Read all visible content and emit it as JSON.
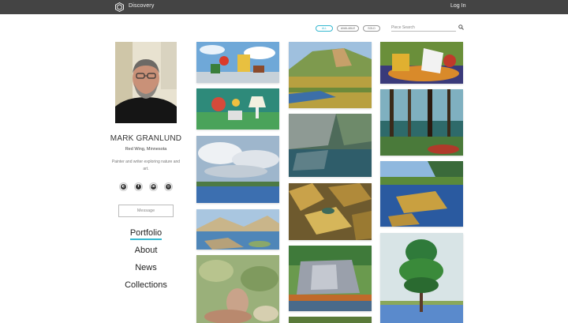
{
  "header": {
    "brand": "Discovery",
    "login": "Log In",
    "logo_icon": "logo-hexagon-icon"
  },
  "filters": {
    "items": [
      "ALL",
      "AVAILABLE",
      "SOLD"
    ],
    "active": "ALL"
  },
  "search": {
    "placeholder": "Piece Search",
    "icon": "search-icon"
  },
  "profile": {
    "name": "MARK GRANLUND",
    "location": "Red Wing, Minnesota",
    "bio": "Painter and writer exploring nature and art.",
    "socials": [
      "website-icon",
      "facebook-icon",
      "linkedin-icon",
      "instagram-icon"
    ],
    "message_label": "Message"
  },
  "nav": {
    "items": [
      "Portfolio",
      "About",
      "News",
      "Collections"
    ],
    "active": "Portfolio"
  },
  "colors": {
    "accent": "#35b8d0",
    "topbar": "#444444"
  }
}
